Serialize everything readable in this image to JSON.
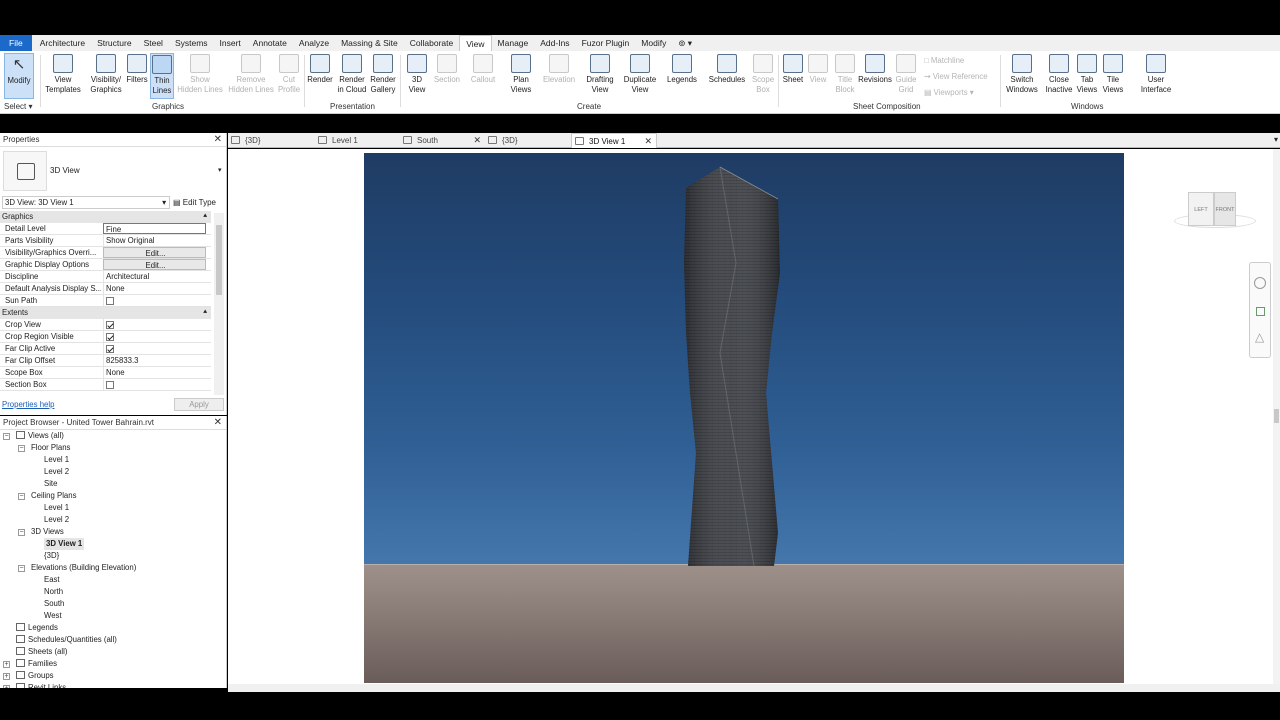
{
  "menu": [
    "File",
    "Architecture",
    "Structure",
    "Steel",
    "Systems",
    "Insert",
    "Annotate",
    "Analyze",
    "Massing & Site",
    "Collaborate",
    "View",
    "Manage",
    "Add-Ins",
    "Fuzor Plugin",
    "Modify"
  ],
  "menu_active": "View",
  "ribbon": {
    "select": {
      "modify": "Modify",
      "select": "Select"
    },
    "graphics": {
      "label": "Graphics",
      "view_templates": [
        "View",
        "Templates"
      ],
      "visibility_graphics": [
        "Visibility/",
        "Graphics"
      ],
      "filters": "Filters",
      "thin_lines": [
        "Thin",
        "Lines"
      ],
      "show_hidden": [
        "Show",
        "Hidden Lines"
      ],
      "remove_hidden": [
        "Remove",
        "Hidden Lines"
      ],
      "cut_profile": [
        "Cut",
        "Profile"
      ]
    },
    "presentation": {
      "label": "Presentation",
      "render": "Render",
      "render_cloud": [
        "Render",
        "in Cloud"
      ],
      "render_gallery": [
        "Render",
        "Gallery"
      ]
    },
    "create": {
      "label": "Create",
      "view_3d": [
        "3D",
        "View"
      ],
      "section": "Section",
      "callout": "Callout",
      "plan_views": [
        "Plan",
        "Views"
      ],
      "elevation": "Elevation",
      "drafting_view": [
        "Drafting",
        "View"
      ],
      "duplicate_view": [
        "Duplicate",
        "View"
      ],
      "legends": "Legends",
      "schedules": "Schedules",
      "scope_box": [
        "Scope",
        "Box"
      ]
    },
    "sheet_composition": {
      "label": "Sheet Composition",
      "sheet": "Sheet",
      "view": "View",
      "title_block": [
        "Title",
        "Block"
      ],
      "revisions": "Revisions",
      "guide_grid": [
        "Guide",
        "Grid"
      ],
      "matchline": "Matchline",
      "view_reference": "View  Reference",
      "viewports": "Viewports"
    },
    "windows": {
      "label": "Windows",
      "switch_windows": [
        "Switch",
        "Windows"
      ],
      "close_inactive": [
        "Close",
        "Inactive"
      ],
      "tab_views": [
        "Tab",
        "Views"
      ],
      "tile_views": [
        "Tile",
        "Views"
      ],
      "user_interface": [
        "User",
        "Interface"
      ]
    }
  },
  "view_tabs": [
    {
      "label": "{3D}",
      "active": false
    },
    {
      "label": "Level 1",
      "active": false
    },
    {
      "label": "South",
      "active": false
    },
    {
      "label": "{3D}",
      "active": false
    },
    {
      "label": "3D View 1",
      "active": true
    }
  ],
  "properties": {
    "title": "Properties",
    "type_name": "3D View",
    "instance_selector": "3D View: 3D View 1",
    "edit_type": "Edit Type",
    "sections": [
      {
        "name": "Graphics",
        "rows": [
          {
            "key": "Detail Level",
            "value": "Fine",
            "kind": "input"
          },
          {
            "key": "Parts Visibility",
            "value": "Show Original",
            "kind": "text"
          },
          {
            "key": "Visibility/Graphics Overri...",
            "value": "Edit...",
            "kind": "button"
          },
          {
            "key": "Graphic Display Options",
            "value": "Edit...",
            "kind": "button"
          },
          {
            "key": "Discipline",
            "value": "Architectural",
            "kind": "text"
          },
          {
            "key": "Default Analysis Display S...",
            "value": "None",
            "kind": "text"
          },
          {
            "key": "Sun Path",
            "value": "",
            "kind": "check",
            "checked": false
          }
        ]
      },
      {
        "name": "Extents",
        "rows": [
          {
            "key": "Crop View",
            "value": "",
            "kind": "check",
            "checked": true
          },
          {
            "key": "Crop Region Visible",
            "value": "",
            "kind": "check",
            "checked": true
          },
          {
            "key": "Far Clip Active",
            "value": "",
            "kind": "check",
            "checked": true
          },
          {
            "key": "Far Clip Offset",
            "value": "825833.3",
            "kind": "text"
          },
          {
            "key": "Scope Box",
            "value": "None",
            "kind": "text"
          },
          {
            "key": "Section Box",
            "value": "",
            "kind": "check",
            "checked": false
          }
        ]
      }
    ],
    "help_link": "Properties help",
    "apply": "Apply"
  },
  "project_browser": {
    "title": "Project Browser - United Tower Bahrain.rvt",
    "tree": [
      {
        "label": "Views (all)",
        "depth": 0
      },
      {
        "label": "Floor Plans",
        "depth": 1
      },
      {
        "label": "Level 1",
        "depth": 2
      },
      {
        "label": "Level 2",
        "depth": 2
      },
      {
        "label": "Site",
        "depth": 2
      },
      {
        "label": "Ceiling Plans",
        "depth": 1
      },
      {
        "label": "Level 1",
        "depth": 2
      },
      {
        "label": "Level 2",
        "depth": 2
      },
      {
        "label": "3D Views",
        "depth": 1
      },
      {
        "label": "3D View 1",
        "depth": 2,
        "selected": true
      },
      {
        "label": "{3D}",
        "depth": 2
      },
      {
        "label": "Elevations (Building Elevation)",
        "depth": 1
      },
      {
        "label": "East",
        "depth": 2
      },
      {
        "label": "North",
        "depth": 2
      },
      {
        "label": "South",
        "depth": 2
      },
      {
        "label": "West",
        "depth": 2
      },
      {
        "label": "Legends",
        "depth": 0
      },
      {
        "label": "Schedules/Quantities (all)",
        "depth": 0
      },
      {
        "label": "Sheets (all)",
        "depth": 0
      },
      {
        "label": "Families",
        "depth": 0
      },
      {
        "label": "Groups",
        "depth": 0
      },
      {
        "label": "Revit Links",
        "depth": 0
      }
    ]
  },
  "viewcube": {
    "left": "LEFT",
    "front": "FRONT"
  },
  "colors": {
    "accent": "#1b6ac9",
    "sky_top": "#1f3c63",
    "sky_horizon": "#9db9d6",
    "ground": "#8a7d78",
    "tower": "#3a3d42"
  }
}
